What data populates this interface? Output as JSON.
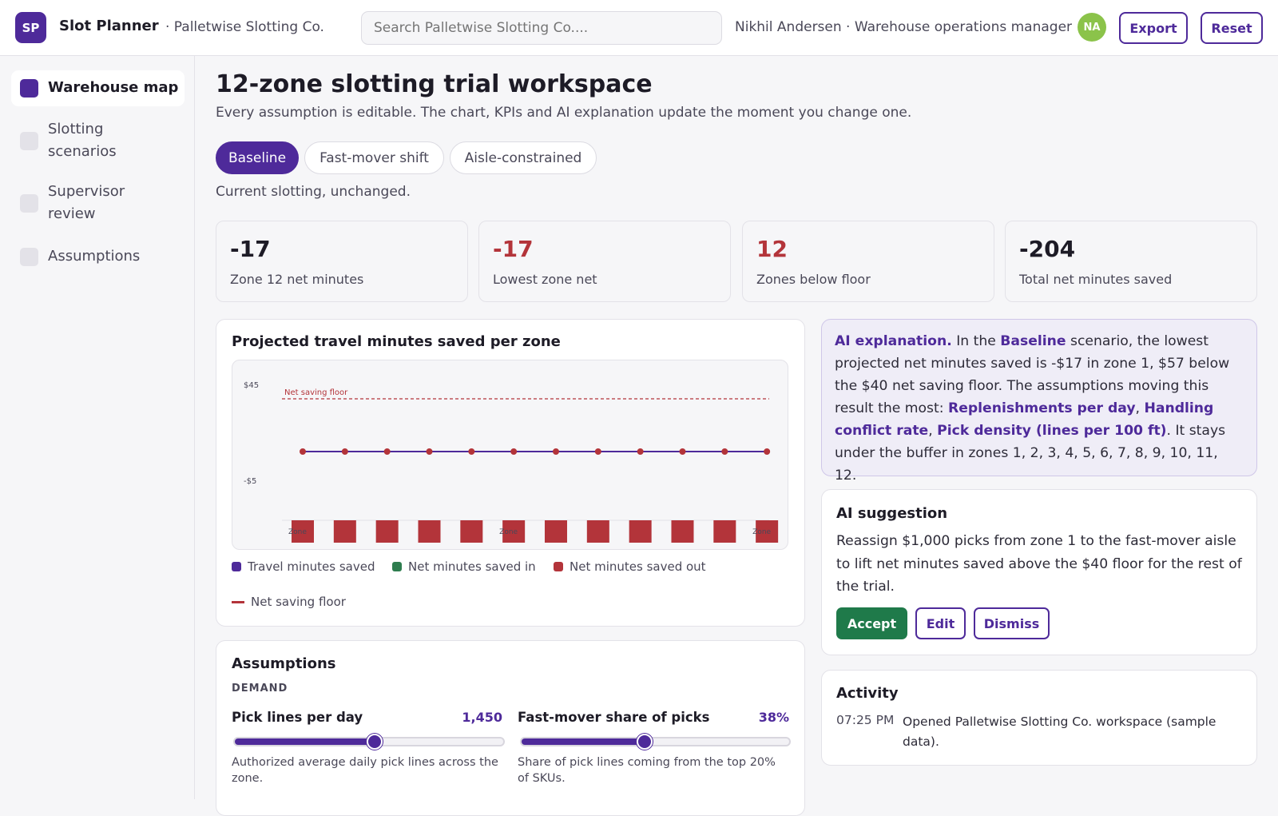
{
  "app": {
    "logo": "SP",
    "name": "Slot Planner",
    "company": "· Palletwise Slotting Co."
  },
  "search": {
    "placeholder": "Search Palletwise Slotting Co...."
  },
  "user": {
    "label": "Nikhil Andersen · Warehouse operations manager",
    "initials": "NA"
  },
  "toolbar": {
    "export_label": "Export",
    "reset_label": "Reset"
  },
  "sidebar": {
    "items": [
      {
        "label": "Warehouse map",
        "active": true
      },
      {
        "label": "Slotting scenarios",
        "active": false
      },
      {
        "label": "Supervisor review",
        "active": false
      },
      {
        "label": "Assumptions",
        "active": false
      }
    ]
  },
  "main": {
    "title": "12-zone slotting trial workspace",
    "subtitle": "Every assumption is editable. The chart, KPIs and AI explanation update the moment you change one.",
    "scenarios": [
      {
        "label": "Baseline",
        "active": true
      },
      {
        "label": "Fast-mover shift",
        "active": false
      },
      {
        "label": "Aisle-constrained",
        "active": false
      }
    ],
    "scenario_desc": "Current slotting, unchanged."
  },
  "kpis": [
    {
      "value": "-17",
      "label": "Zone 12 net minutes",
      "color": "#1d1b26"
    },
    {
      "value": "-17",
      "label": "Lowest zone net",
      "color": "#b3343a"
    },
    {
      "value": "12",
      "label": "Zones below floor",
      "color": "#b3343a"
    },
    {
      "value": "-204",
      "label": "Total net minutes saved",
      "color": "#1d1b26"
    }
  ],
  "chart_card": {
    "title": "Projected travel minutes saved per zone"
  },
  "chart_data": {
    "type": "line",
    "title": "Projected travel minutes saved per zone",
    "x": [
      1,
      2,
      3,
      4,
      5,
      6,
      7,
      8,
      9,
      10,
      11,
      12
    ],
    "ytick_labels": [
      "$45",
      "-$5"
    ],
    "xtick_labels": [
      "Zone",
      "Zone",
      "Zone"
    ],
    "series": [
      {
        "name": "Travel minutes saved",
        "type": "line",
        "color": "#4e2a9a",
        "values": [
          10,
          10,
          10,
          10,
          10,
          10,
          10,
          10,
          10,
          10,
          10,
          10
        ]
      },
      {
        "name": "Net minutes saved in",
        "type": "bar",
        "color": "#2e7d4f",
        "values": []
      },
      {
        "name": "Net minutes saved out",
        "type": "bar",
        "color": "#b3343a",
        "values": [
          -17,
          -17,
          -17,
          -17,
          -17,
          -17,
          -17,
          -17,
          -17,
          -17,
          -17,
          -17
        ]
      }
    ],
    "reference_line": {
      "label": "Net saving floor",
      "value": 40,
      "color": "#b3343a"
    },
    "legend": [
      "Travel minutes saved",
      "Net minutes saved in",
      "Net minutes saved out",
      "Net saving floor"
    ],
    "legend_position": "bottom",
    "grid": false
  },
  "ai_explanation": {
    "lead": "AI explanation.",
    "t1": " In the ",
    "scenario": "Baseline",
    "t2": " scenario, the lowest projected net minutes saved is -$17 in zone 1, $57 below the $40 net saving floor. The assumptions moving this result the most: ",
    "f1": "Replenishments per day",
    "sep1": ", ",
    "f2": "Handling conflict rate",
    "sep2": ", ",
    "f3": "Pick density (lines per 100 ft)",
    "t3": ". It stays under the buffer in zones 1, 2, 3, 4, 5, 6, 7, 8, 9, 10, 11, 12."
  },
  "ai_suggestion": {
    "title": "AI suggestion",
    "text": "Reassign $1,000 picks from zone 1 to the fast-mover aisle to lift net minutes saved above the $40 floor for the rest of the trial.",
    "accept_label": "Accept",
    "edit_label": "Edit",
    "dismiss_label": "Dismiss"
  },
  "assumptions": {
    "title": "Assumptions",
    "section": "DEMAND",
    "sliders": [
      {
        "label": "Pick lines per day",
        "value": "1,450",
        "fraction": 0.52,
        "help": "Authorized average daily pick lines across the zone."
      },
      {
        "label": "Fast-mover share of picks",
        "value": "38%",
        "fraction": 0.46,
        "help": "Share of pick lines coming from the top 20% of SKUs."
      }
    ]
  },
  "activity": {
    "title": "Activity",
    "items": [
      {
        "time": "07:25 PM",
        "text": "Opened Palletwise Slotting Co. workspace (sample data)."
      }
    ]
  }
}
